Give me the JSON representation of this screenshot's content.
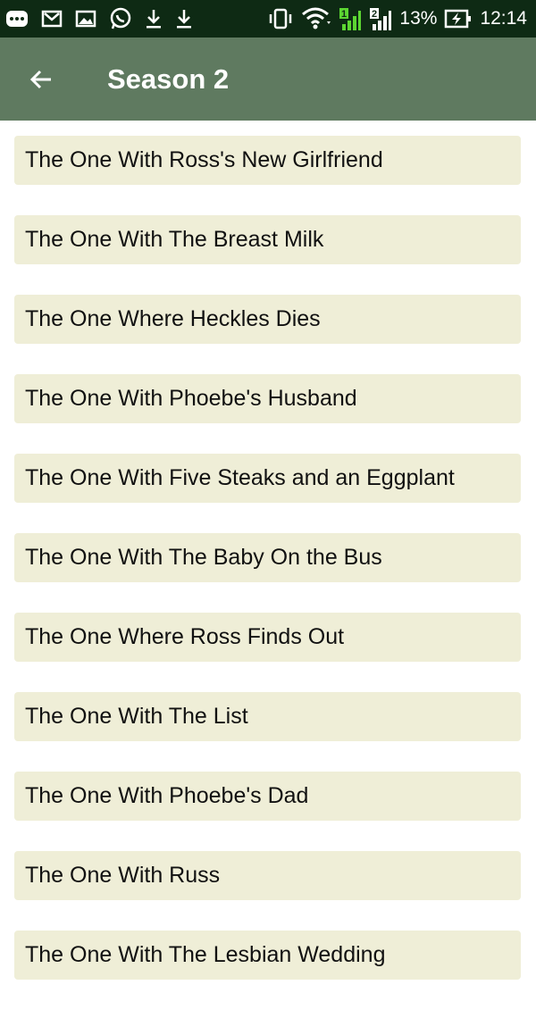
{
  "status_bar": {
    "icons": [
      "more-icon",
      "gmail-icon",
      "image-icon",
      "whatsapp-icon",
      "download-icon",
      "download-icon",
      "vibrate-icon",
      "wifi-icon",
      "signal-sim1-icon",
      "signal-sim2-icon",
      "battery-charging-icon"
    ],
    "battery": "13%",
    "time": "12:14"
  },
  "app_bar": {
    "back_icon": "arrow-left-icon",
    "title": "Season 2"
  },
  "episodes": [
    {
      "title": "The One With Ross's New Girlfriend"
    },
    {
      "title": "The One With The Breast Milk"
    },
    {
      "title": "The One Where Heckles Dies"
    },
    {
      "title": "The One With Phoebe's Husband"
    },
    {
      "title": "The One With Five Steaks and an Eggplant"
    },
    {
      "title": "The One With The Baby On the Bus"
    },
    {
      "title": "The One Where Ross Finds Out"
    },
    {
      "title": "The One With The List"
    },
    {
      "title": "The One With Phoebe's Dad"
    },
    {
      "title": "The One With Russ"
    },
    {
      "title": "The One With The Lesbian Wedding"
    }
  ],
  "colors": {
    "status_bar": "#0e2a14",
    "app_bar": "#5f7a60",
    "item_background": "#efeed7",
    "signal_accent": "#5cd632"
  }
}
